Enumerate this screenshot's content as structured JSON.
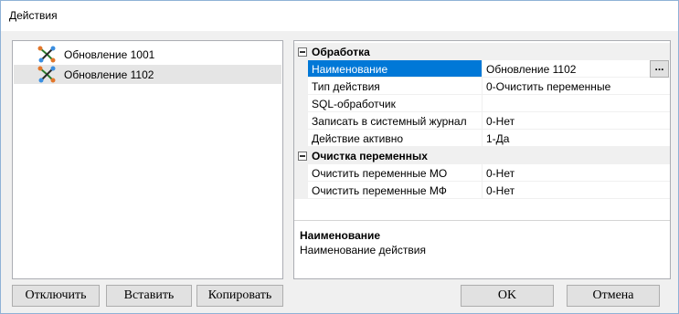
{
  "window": {
    "title": "Действия"
  },
  "tree": {
    "items": [
      {
        "label": "Обновление 1001",
        "icon": "action-icon"
      },
      {
        "label": "Обновление 1102",
        "icon": "action-icon",
        "selected": true
      }
    ]
  },
  "properties": {
    "categories": [
      {
        "label": "Обработка",
        "rows": [
          {
            "name": "Наименование",
            "value": "Обновление 1102",
            "selected": true,
            "has_ellipsis": true
          },
          {
            "name": "Тип действия",
            "value": "0-Очистить переменные"
          },
          {
            "name": "SQL-обработчик",
            "value": ""
          },
          {
            "name": "Записать в системный журнал",
            "value": "0-Нет"
          },
          {
            "name": "Действие активно",
            "value": "1-Да"
          }
        ]
      },
      {
        "label": "Очистка переменных",
        "rows": [
          {
            "name": "Очистить переменные МО",
            "value": "0-Нет"
          },
          {
            "name": "Очистить переменные МФ",
            "value": "0-Нет"
          }
        ]
      }
    ],
    "ellipsis_label": "...",
    "description": {
      "title": "Наименование",
      "text": "Наименование действия"
    }
  },
  "buttons": {
    "disable": "Отключить",
    "paste": "Вставить",
    "copy": "Копировать",
    "ok": "OK",
    "cancel": "Отмена"
  },
  "colors": {
    "selection_blue": "#0078d7",
    "window_border": "#8fb2d6",
    "background": "#f0f0f0"
  }
}
